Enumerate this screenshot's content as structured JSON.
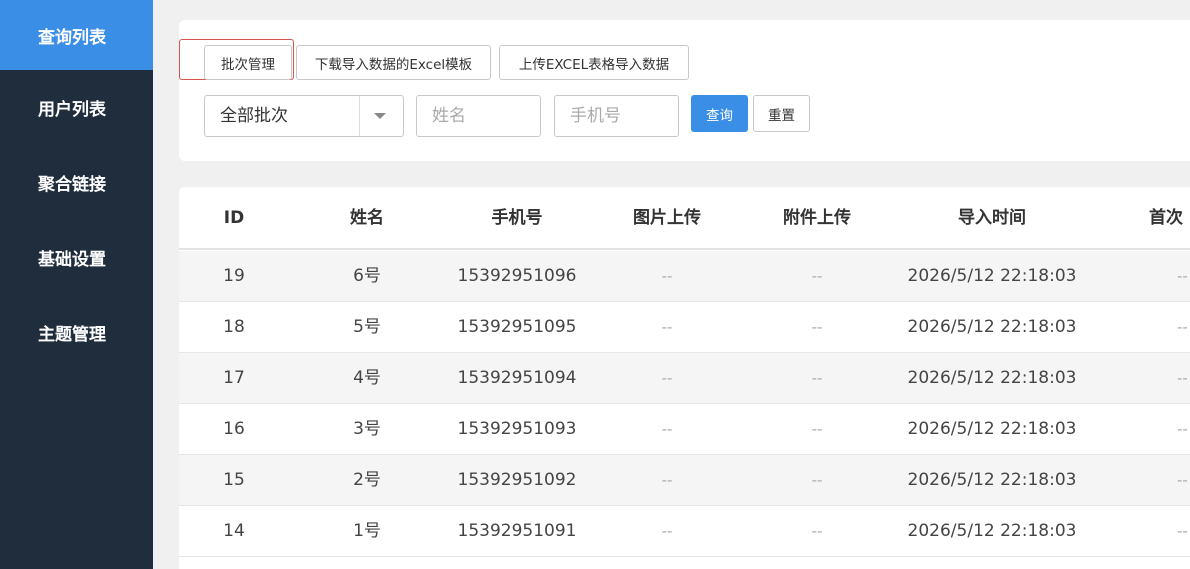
{
  "sidebar": {
    "items": [
      {
        "label": "查询列表"
      },
      {
        "label": "用户列表"
      },
      {
        "label": "聚合链接"
      },
      {
        "label": "基础设置"
      },
      {
        "label": "主题管理"
      }
    ]
  },
  "toolbar": {
    "batch_manage_label": "批次管理",
    "download_template_label": "下载导入数据的Excel模板",
    "upload_excel_label": "上传EXCEL表格导入数据"
  },
  "filters": {
    "batch_select_value": "全部批次",
    "name_placeholder": "姓名",
    "phone_placeholder": "手机号",
    "query_label": "查询",
    "reset_label": "重置"
  },
  "table": {
    "columns": [
      "ID",
      "姓名",
      "手机号",
      "图片上传",
      "附件上传",
      "导入时间",
      "首次"
    ],
    "rows": [
      [
        "19",
        "6号",
        "15392951096",
        "--",
        "--",
        "2026/5/12 22:18:03",
        "--"
      ],
      [
        "18",
        "5号",
        "15392951095",
        "--",
        "--",
        "2026/5/12 22:18:03",
        "--"
      ],
      [
        "17",
        "4号",
        "15392951094",
        "--",
        "--",
        "2026/5/12 22:18:03",
        "--"
      ],
      [
        "16",
        "3号",
        "15392951093",
        "--",
        "--",
        "2026/5/12 22:18:03",
        "--"
      ],
      [
        "15",
        "2号",
        "15392951092",
        "--",
        "--",
        "2026/5/12 22:18:03",
        "--"
      ],
      [
        "14",
        "1号",
        "15392951091",
        "--",
        "--",
        "2026/5/12 22:18:03",
        "--"
      ]
    ]
  },
  "colors": {
    "sidebar_bg": "#1f2d3d",
    "accent": "#3a8ee6",
    "highlight_border": "#d9534f"
  }
}
